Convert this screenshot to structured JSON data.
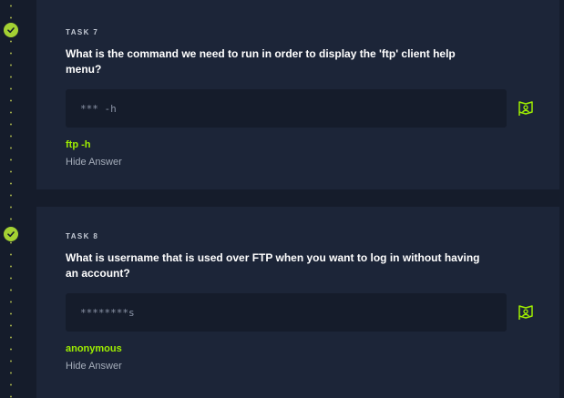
{
  "colors": {
    "accent": "#9fef00",
    "check": "#a3d133",
    "card": "#1c2538",
    "background": "#151c2b"
  },
  "tasks": [
    {
      "label": "TASK 7",
      "question": "What is the command we need to run in order to display the 'ftp' client help menu?",
      "placeholder": "*** -h",
      "answer": "ftp -h",
      "hide_label": "Hide Answer",
      "completed": true
    },
    {
      "label": "TASK 8",
      "question": "What is username that is used over FTP when you want to log in without having an account?",
      "placeholder": "********s",
      "answer": "anonymous",
      "hide_label": "Hide Answer",
      "completed": true
    }
  ]
}
